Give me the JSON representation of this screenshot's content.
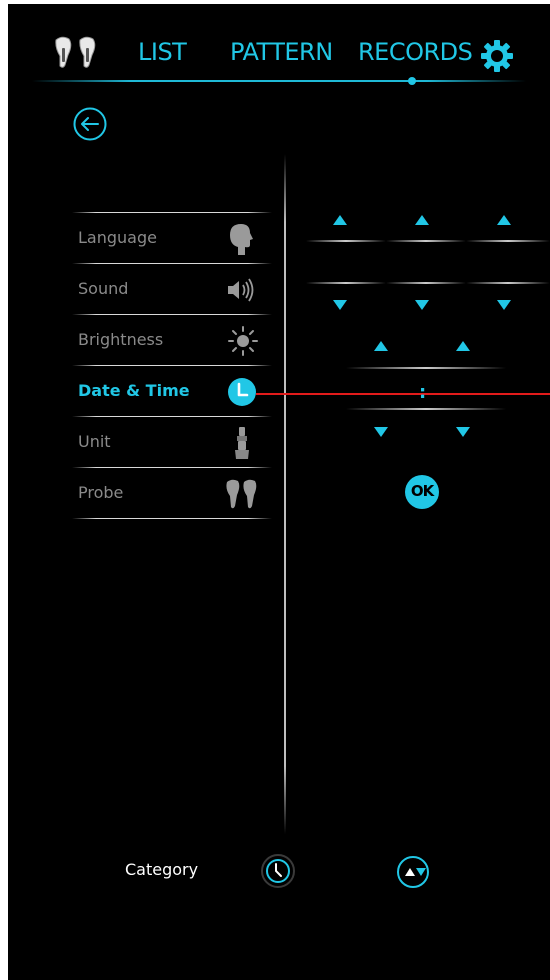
{
  "nav": {
    "tabs": [
      {
        "label": "LIST"
      },
      {
        "label": "PATTERN"
      },
      {
        "label": "RECORDS"
      }
    ],
    "active_indicator": "RECORDS",
    "icons": {
      "probes": "earbud-probes-icon",
      "settings": "gear-icon",
      "back": "back-arrow-icon"
    }
  },
  "settings_menu": {
    "items": [
      {
        "label": "Language",
        "icon": "head-profile-icon"
      },
      {
        "label": "Sound",
        "icon": "speaker-icon"
      },
      {
        "label": "Brightness",
        "icon": "sun-icon"
      },
      {
        "label": "Date & Time",
        "icon": "clock-icon",
        "active": true
      },
      {
        "label": "Unit",
        "icon": "probe-unit-icon"
      },
      {
        "label": "Probe",
        "icon": "earbud-probes-icon"
      }
    ]
  },
  "datetime_editor": {
    "date_fields": 3,
    "time_fields": 2,
    "time_separator": ":",
    "ok_label": "OK"
  },
  "bottom_bar": {
    "category_label": "Category",
    "icons": {
      "clock": "clock-icon",
      "updown": "up-down-icon"
    }
  },
  "colors": {
    "accent": "#21c7e6",
    "background": "#000000",
    "inactive_text": "#8a8a8a",
    "connector": "#e21b1b"
  }
}
